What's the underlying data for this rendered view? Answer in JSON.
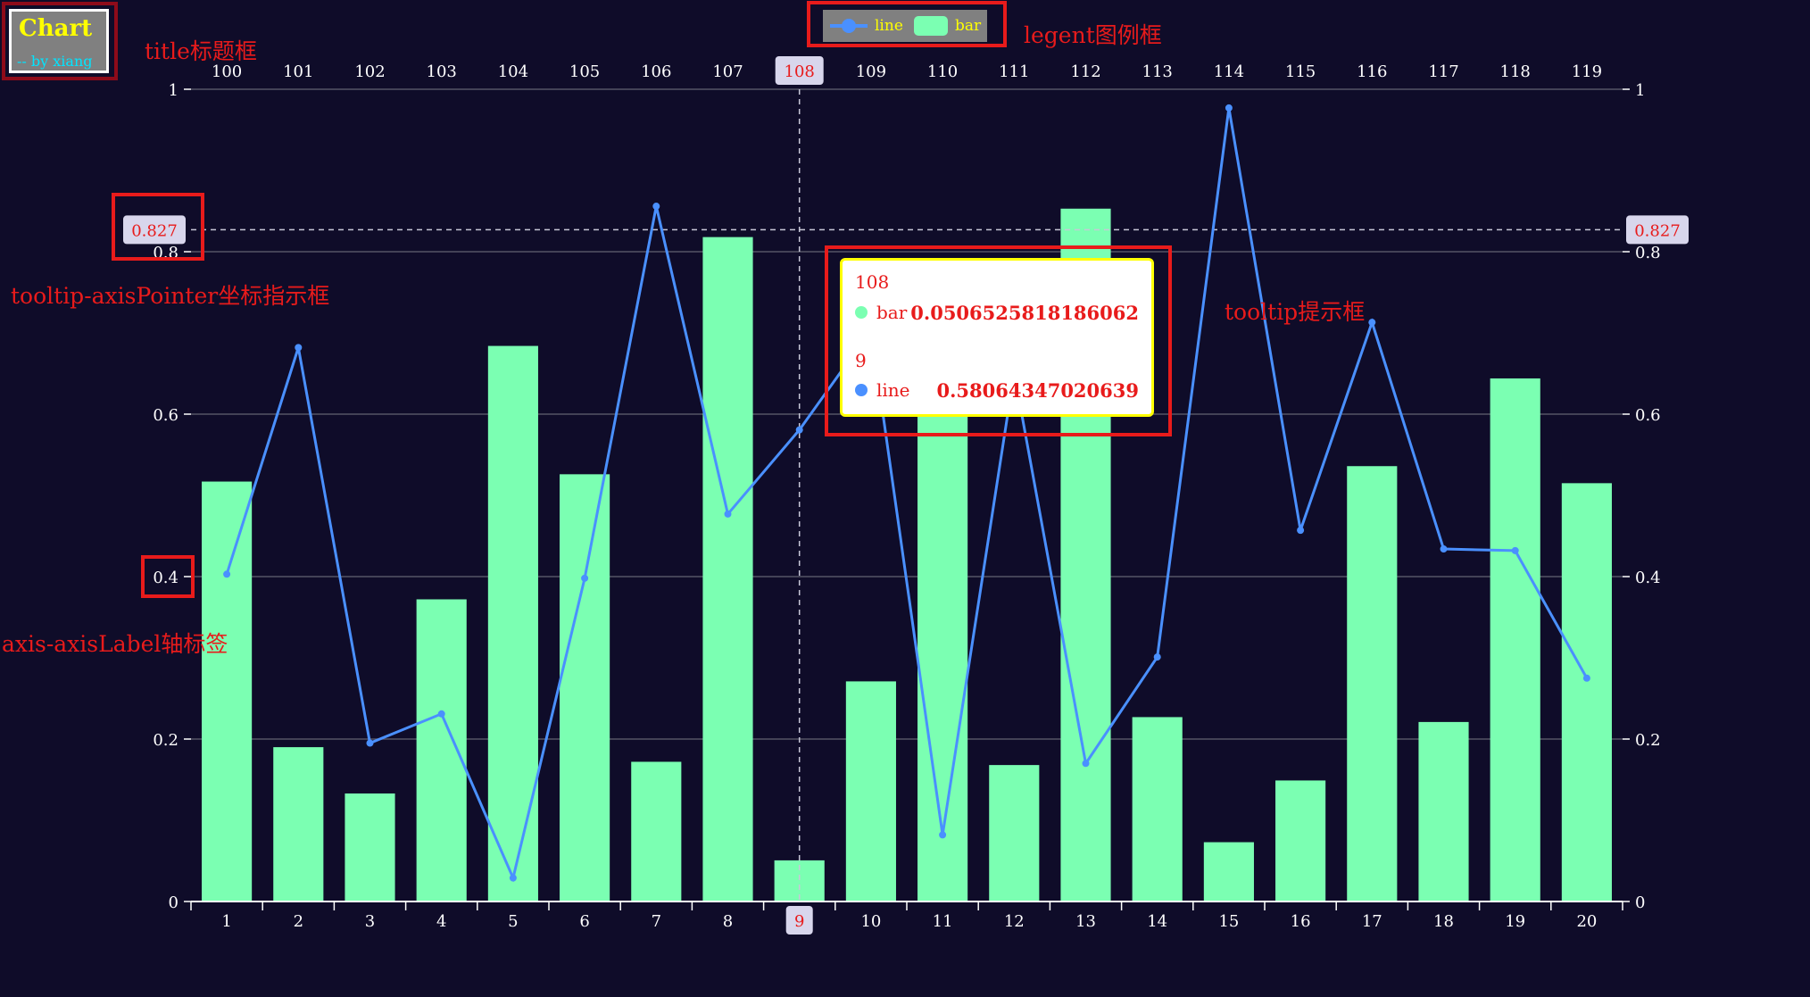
{
  "title": {
    "text": "Chart",
    "subtext": "-- by xiang"
  },
  "legend": {
    "items": [
      {
        "name": "line",
        "color": "#4a90ff"
      },
      {
        "name": "bar",
        "color": "#7bffb2"
      }
    ]
  },
  "annotations": {
    "title": "title标题框",
    "legend": "legent图例框",
    "axis_pointer": "tooltip-axisPointer坐标指示框",
    "tooltip": "tooltip提示框",
    "axis_label": "axis-axisLabel轴标签"
  },
  "tooltip": {
    "top_category": "108",
    "bar_name": "bar",
    "bar_value": "0.0506525818186062",
    "bottom_category": "9",
    "line_name": "line",
    "line_value": "0.58064347020639"
  },
  "pointer": {
    "y_value": "0.827",
    "x_category": "9",
    "top_category": "108"
  },
  "colors": {
    "background": "#0f0c29",
    "bar": "#7bffb2",
    "line": "#4a90ff",
    "axis": "#ffffff",
    "highlight": "#e81b1b"
  },
  "chart_data": {
    "type": "bar",
    "categories": [
      "1",
      "2",
      "3",
      "4",
      "5",
      "6",
      "7",
      "8",
      "9",
      "10",
      "11",
      "12",
      "13",
      "14",
      "15",
      "16",
      "17",
      "18",
      "19",
      "20"
    ],
    "top_categories": [
      "100",
      "101",
      "102",
      "103",
      "104",
      "105",
      "106",
      "107",
      "108",
      "109",
      "110",
      "111",
      "112",
      "113",
      "114",
      "115",
      "116",
      "117",
      "118",
      "119"
    ],
    "series": [
      {
        "name": "bar",
        "type": "bar",
        "xaxis": "top",
        "values": [
          0.517,
          0.19,
          0.133,
          0.372,
          0.684,
          0.526,
          0.172,
          0.818,
          0.0506525818186062,
          0.271,
          0.61,
          0.168,
          0.853,
          0.227,
          0.073,
          0.149,
          0.536,
          0.221,
          0.644,
          0.515
        ]
      },
      {
        "name": "line",
        "type": "line",
        "xaxis": "bottom",
        "values": [
          0.403,
          0.682,
          0.195,
          0.231,
          0.029,
          0.398,
          0.856,
          0.477,
          0.58064347020639,
          0.704,
          0.082,
          0.651,
          0.17,
          0.301,
          0.977,
          0.457,
          0.713,
          0.434,
          0.432,
          0.275
        ]
      }
    ],
    "yticks": [
      "0",
      "0.2",
      "0.4",
      "0.6",
      "0.8",
      "1"
    ],
    "ylim": [
      0,
      1
    ],
    "highlight_index": 8,
    "pointer_y": 0.827
  }
}
